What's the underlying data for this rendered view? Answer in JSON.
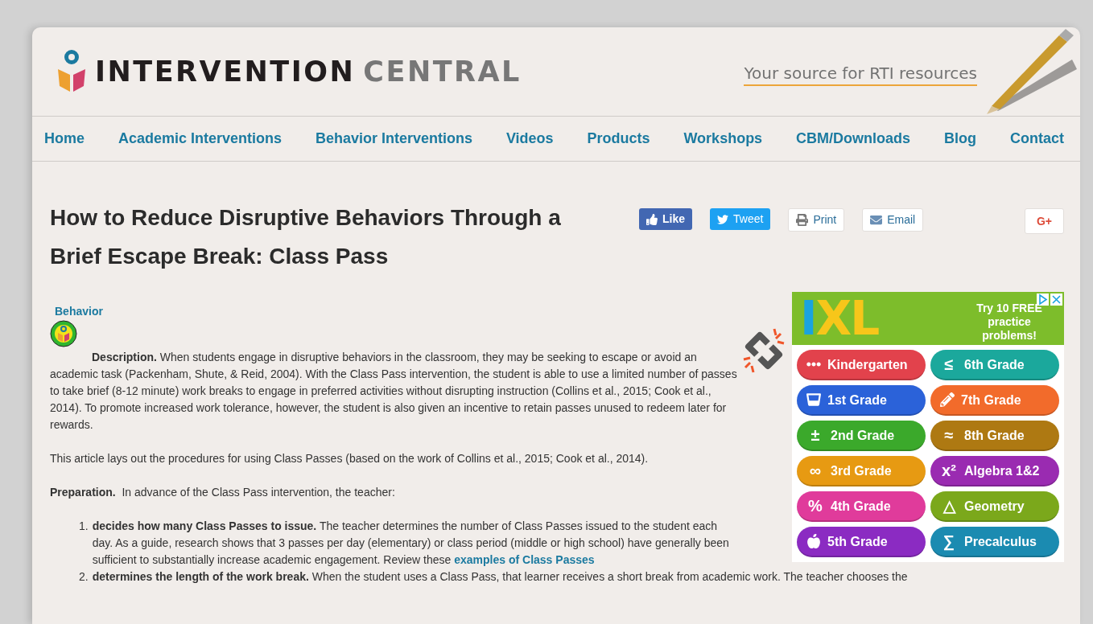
{
  "header": {
    "logo_dark": "INTERVENTION",
    "logo_light": "CENTRAL",
    "tagline": "Your source for RTI resources"
  },
  "nav": [
    {
      "label": "Home"
    },
    {
      "label": "Academic Interventions"
    },
    {
      "label": "Behavior Interventions"
    },
    {
      "label": "Videos"
    },
    {
      "label": "Products"
    },
    {
      "label": "Workshops"
    },
    {
      "label": "CBM/Downloads"
    },
    {
      "label": "Blog"
    },
    {
      "label": "Contact"
    }
  ],
  "article": {
    "title": "How to Reduce Disruptive Behaviors Through a Brief Escape Break: Class Pass",
    "share": [
      {
        "kind": "like",
        "label": "Like"
      },
      {
        "kind": "tweet",
        "label": "Tweet"
      },
      {
        "kind": "print",
        "label": "Print"
      },
      {
        "kind": "email",
        "label": "Email"
      },
      {
        "kind": "gplus",
        "label": "G+"
      }
    ],
    "category": "Behavior",
    "description": "**Description.** When students engage in disruptive behaviors in the classroom, they may be seeking to escape or avoid an academic task (Packenham, Shute, & Reid, 2004). With the Class Pass intervention, the student is able to use a limited number of passes to take brief (8-12 minute) work breaks to engage in preferred activities without disrupting instruction (Collins et al., 2015; Cook et al., 2014). To promote increased work tolerance, however, the student is also given an incentive to retain passes unused to redeem later for rewards.",
    "intro": "This article lays out the procedures for using Class Passes (based on the work of Collins et al., 2015; Cook et al., 2014).",
    "preparation": "**Preparation.**  In advance of the Class Pass intervention, the teacher:",
    "steps": [
      {
        "number": "1.",
        "text": "**decides how many Class Passes to issue.** The teacher determines the number of Class Passes issued to the student each day. As a guide, research shows that 3 passes per day (elementary) or class period (middle or high school) have generally been sufficient to substantially increase academic engagement. Review these",
        "link": "examples of Class Passes"
      },
      {
        "number": "2.",
        "text": "**determines the length of the work break.** When the student uses a Class Pass, that learner receives a short break from academic work. The teacher chooses the"
      }
    ]
  },
  "ad": {
    "logo": "IXL",
    "headline": "Try 10 FREE practice problems!",
    "buttons": [
      {
        "label": "Kindergarten",
        "color": "#e2424c"
      },
      {
        "label": "6th Grade",
        "symbol": "≤",
        "color": "#1ba89c"
      },
      {
        "label": "1st Grade",
        "color": "#2b62d9"
      },
      {
        "label": "7th Grade",
        "color": "#f26b2b"
      },
      {
        "label": "2nd Grade",
        "symbol": "±",
        "color": "#3ba92b"
      },
      {
        "label": "8th Grade",
        "symbol": "≈",
        "color": "#ae7912"
      },
      {
        "label": "3rd Grade",
        "symbol": "∞",
        "color": "#e79a12"
      },
      {
        "label": "Algebra 1&2",
        "symbol": "x²",
        "color": "#9a2bb1"
      },
      {
        "label": "4th Grade",
        "symbol": "%",
        "color": "#e03b9b"
      },
      {
        "label": "Geometry",
        "symbol": "△",
        "color": "#7ba81b"
      },
      {
        "label": "5th Grade",
        "color": "#8b2bc2"
      },
      {
        "label": "Precalculus",
        "symbol": "∑",
        "color": "#1b8bb1"
      }
    ]
  }
}
